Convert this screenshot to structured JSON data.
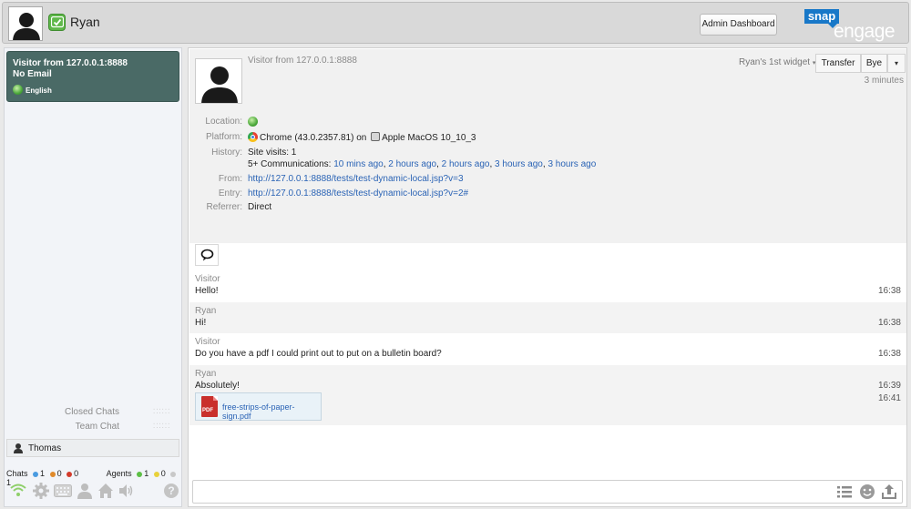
{
  "topbar": {
    "agent_name": "Ryan",
    "admin_button": "Admin Dashboard",
    "logo_snap": "snap",
    "logo_engage": "engage"
  },
  "sidebar": {
    "active_chat": {
      "title": "Visitor from 127.0.0.1:8888",
      "email": "No Email",
      "language": "English"
    },
    "links": {
      "closed_chats": "Closed Chats",
      "team_chat": "Team Chat"
    },
    "agent": {
      "name": "Thomas"
    },
    "stats": {
      "chats_label": "Chats",
      "chats": [
        {
          "color": "#4a9be0",
          "count": "1"
        },
        {
          "color": "#e08a2a",
          "count": "0"
        },
        {
          "color": "#d23a2a",
          "count": "0"
        }
      ],
      "agents_label": "Agents",
      "agents": [
        {
          "color": "#5cbf45",
          "count": "1"
        },
        {
          "color": "#e8d13a",
          "count": "0"
        },
        {
          "color": "#c8c8c8",
          "count": "1"
        }
      ]
    },
    "toolbar_icons": [
      "wifi-icon",
      "gear-icon",
      "keyboard-icon",
      "user-icon",
      "home-icon",
      "speaker-icon",
      "help-icon"
    ]
  },
  "main": {
    "header": {
      "visitor_title": "Visitor from 127.0.0.1:8888",
      "widget": "Ryan's 1st widget",
      "transfer": "Transfer",
      "bye": "Bye",
      "duration": "3 minutes"
    },
    "info": {
      "location_label": "Location:",
      "platform_label": "Platform:",
      "browser": "Chrome (43.0.2357.81)",
      "on_word": "on",
      "os": "Apple MacOS 10_10_3",
      "history_label": "History:",
      "site_visits": "Site visits: 1",
      "communications_prefix": "5+ Communications:",
      "communications": [
        "10 mins ago",
        "2 hours ago",
        "2 hours ago",
        "3 hours ago",
        "3 hours ago"
      ],
      "from_label": "From:",
      "from_url": "http://127.0.0.1:8888/tests/test-dynamic-local.jsp?v=3",
      "entry_label": "Entry:",
      "entry_url": "http://127.0.0.1:8888/tests/test-dynamic-local.jsp?v=2#",
      "referrer_label": "Referrer:",
      "referrer": "Direct"
    },
    "messages": [
      {
        "sender": "Visitor",
        "text": "Hello!",
        "time": "16:38"
      },
      {
        "sender": "Ryan",
        "text": "Hi!",
        "time": "16:38"
      },
      {
        "sender": "Visitor",
        "text": "Do you have a pdf I could print out to put on a bulletin board?",
        "time": "16:38"
      },
      {
        "sender": "Ryan",
        "text": "Absolutely!",
        "time": "16:39",
        "attachment": "free-strips-of-paper-sign.pdf",
        "attachment_time": "16:41",
        "attachment_badge": "PDF"
      }
    ],
    "compose": {
      "placeholder": ""
    }
  }
}
